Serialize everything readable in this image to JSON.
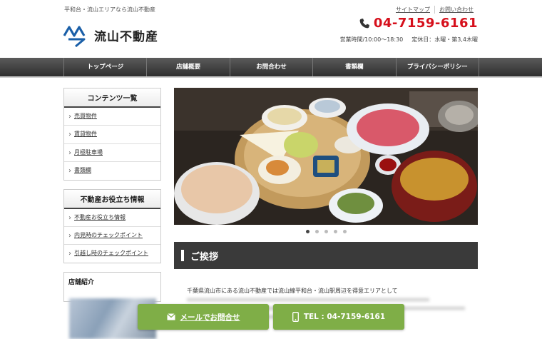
{
  "header": {
    "tagline": "平和台・流山エリアなら流山不動産",
    "logo_text": "流山不動産",
    "top_links": [
      "サイトマップ",
      "お問い合わせ"
    ],
    "phone": "04-7159-6161",
    "hours": "営業時間/10:00〜18:30",
    "holiday": "定休日：水曜・第3,4木曜",
    "brand_color": "#d6101c"
  },
  "nav": {
    "items": [
      "トップページ",
      "店舗概要",
      "お問合わせ",
      "書類欄",
      "プライバシーポリシー"
    ]
  },
  "sidebar": {
    "contents_title": "コンテンツ一覧",
    "contents": [
      "売買物件",
      "賃貸物件",
      "月極駐車場",
      "書類欄"
    ],
    "useful_title": "不動産お役立ち情報",
    "useful": [
      "不動産お役立ち情報",
      "内見時のチェックポイント",
      "引越し時のチェックポイント"
    ],
    "shop_title": "店舗紹介"
  },
  "slider": {
    "dot_count": 5,
    "active_index": 0
  },
  "greeting": {
    "title": "ご挨拶",
    "text": "千葉県流山市にある流山不動産では流山線平和台・流山駅周辺を得意エリアとして"
  },
  "cta": {
    "mail_label": "メールでお問合せ",
    "tel_label": "TEL : 04-7159-6161",
    "color": "#7fae47"
  }
}
